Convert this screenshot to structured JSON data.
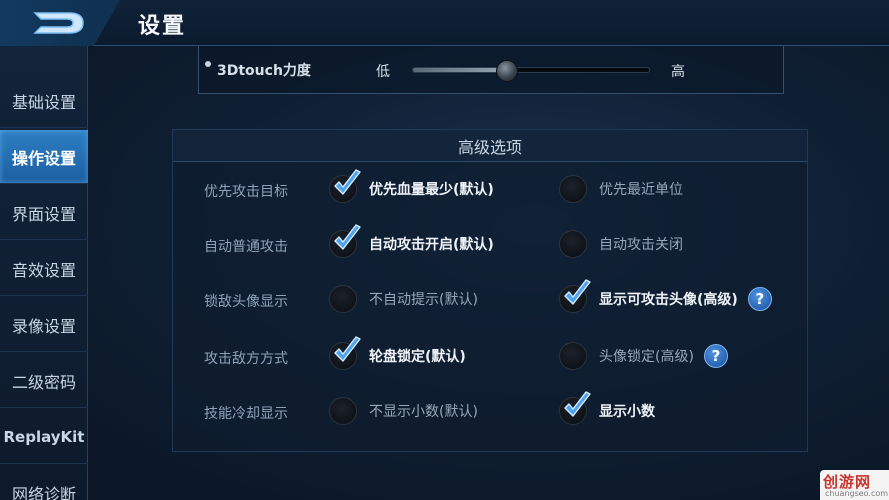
{
  "header": {
    "title": "设置"
  },
  "sidebar": {
    "items": [
      {
        "label": "基础设置",
        "active": false
      },
      {
        "label": "操作设置",
        "active": true
      },
      {
        "label": "界面设置",
        "active": false
      },
      {
        "label": "音效设置",
        "active": false
      },
      {
        "label": "录像设置",
        "active": false
      },
      {
        "label": "二级密码",
        "active": false
      },
      {
        "label": "ReplayKit",
        "active": false
      },
      {
        "label": "网络诊断",
        "active": false
      }
    ]
  },
  "touch_slider": {
    "label": "3Dtouch力度",
    "low_label": "低",
    "high_label": "高",
    "value_percent": 40
  },
  "advanced": {
    "title": "高级选项",
    "rows": [
      {
        "label": "优先攻击目标",
        "options": [
          {
            "text": "优先血量最少(默认)",
            "checked": true,
            "help": false
          },
          {
            "text": "优先最近单位",
            "checked": false,
            "help": false
          }
        ]
      },
      {
        "label": "自动普通攻击",
        "options": [
          {
            "text": "自动攻击开启(默认)",
            "checked": true,
            "help": false
          },
          {
            "text": "自动攻击关闭",
            "checked": false,
            "help": false
          }
        ]
      },
      {
        "label": "锁敌头像显示",
        "options": [
          {
            "text": "不自动提示(默认)",
            "checked": false,
            "help": false
          },
          {
            "text": "显示可攻击头像(高级)",
            "checked": true,
            "help": true
          }
        ]
      },
      {
        "label": "攻击敌方方式",
        "options": [
          {
            "text": "轮盘锁定(默认)",
            "checked": true,
            "help": false
          },
          {
            "text": "头像锁定(高级)",
            "checked": false,
            "help": true
          }
        ]
      },
      {
        "label": "技能冷却显示",
        "options": [
          {
            "text": "不显示小数(默认)",
            "checked": false,
            "help": false
          },
          {
            "text": "显示小数",
            "checked": true,
            "help": false
          }
        ]
      }
    ]
  },
  "help_label": "?",
  "watermark": {
    "brand": "创游网",
    "domain": "chuangseo.com"
  },
  "colors": {
    "accent": "#2e7fc4",
    "check": "#4fa3f0",
    "help_bubble": "#2763b4"
  }
}
